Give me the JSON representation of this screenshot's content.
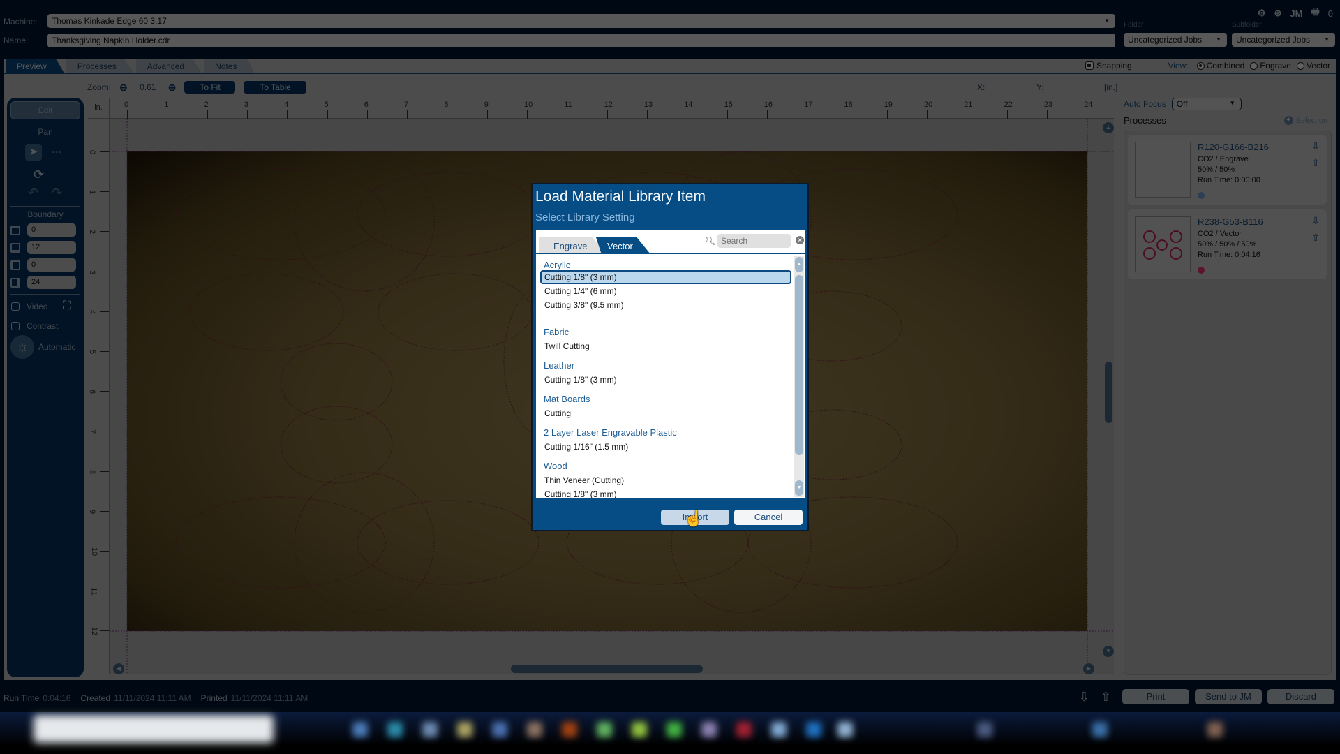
{
  "header": {
    "machine_label": "Machine:",
    "machine_value": "Thomas Kinkade Edge 60 3.17",
    "name_label": "Name:",
    "name_value": "Thanksgiving Napkin Holder.cdr",
    "folder_caption": "Folder",
    "folder_value": "Uncategorized Jobs",
    "subfolder_caption": "Subfolder",
    "subfolder_value": "Uncategorized Jobs",
    "top_icons": [
      "gear-icon",
      "activity-icon",
      "JM",
      "printer-icon",
      "0"
    ],
    "jm_label": "JM",
    "queue_count": "0"
  },
  "tabs": [
    {
      "label": "Preview",
      "active": true
    },
    {
      "label": "Processes",
      "active": false
    },
    {
      "label": "Advanced",
      "active": false
    },
    {
      "label": "Notes",
      "active": false
    }
  ],
  "view": {
    "snapping_label": "Snapping",
    "snapping_checked": true,
    "view_label": "View:",
    "options": [
      {
        "label": "Combined",
        "selected": true
      },
      {
        "label": "Engrave",
        "selected": false
      },
      {
        "label": "Vector",
        "selected": false
      }
    ]
  },
  "zoom": {
    "label": "Zoom:",
    "value": "0.61",
    "to_fit": "To Fit",
    "to_table": "To Table",
    "x_label": "X:",
    "y_label": "Y:",
    "unit": "[in.]"
  },
  "left_panel": {
    "edit_label": "Edit",
    "pan_label": "Pan",
    "tool_placeholder": "---",
    "boundary_label": "Boundary",
    "boundary_values": [
      "0",
      "12",
      "0",
      "24"
    ],
    "video_label": "Video",
    "contrast_label": "Contrast",
    "automatic_label": "Automatic"
  },
  "ruler": {
    "unit": "in.",
    "top_ticks": [
      "0",
      "1",
      "2",
      "3",
      "4",
      "5",
      "6",
      "7",
      "8",
      "9",
      "10",
      "11",
      "12",
      "13",
      "14",
      "15",
      "16",
      "17",
      "18",
      "19",
      "20",
      "21",
      "22",
      "23",
      "24"
    ],
    "left_ticks": [
      "0",
      "1",
      "2",
      "3",
      "4",
      "5",
      "6",
      "7",
      "8",
      "9",
      "10",
      "11",
      "12"
    ]
  },
  "right_panel": {
    "auto_focus_label": "Auto Focus",
    "auto_focus_value": "Off",
    "processes_label": "Processes",
    "selection_label": "Selection",
    "processes": [
      {
        "title": "R120-G166-B216",
        "type": "CO2 / Engrave",
        "settings": "50% / 50%",
        "run_time": "Run Time: 0:00:00",
        "color": "#78a6d8"
      },
      {
        "title": "R238-G53-B116",
        "type": "CO2 / Vector",
        "settings": "50% / 50% / 50%",
        "run_time": "Run Time: 0:04:16",
        "color": "#ee3574"
      }
    ]
  },
  "status": {
    "run_time_label": "Run Time",
    "run_time_value": "0:04:16",
    "created_label": "Created",
    "created_value": "11/11/2024 11:11 AM",
    "printed_label": "Printed",
    "printed_value": "11/11/2024 11:11 AM"
  },
  "actions": {
    "print": "Print",
    "send_to_jm": "Send to JM",
    "discard": "Discard"
  },
  "dialog": {
    "title": "Load Material Library Item",
    "subtitle": "Select Library Setting",
    "tabs": [
      {
        "label": "Engrave",
        "active": false
      },
      {
        "label": "Vector",
        "active": true
      }
    ],
    "search_placeholder": "Search",
    "groups": [
      {
        "category": "Acrylic",
        "items": [
          "Cutting 1/8\" (3 mm)",
          "Cutting 1/4\" (6 mm)",
          "Cutting 3/8\" (9.5 mm)"
        ]
      },
      {
        "category": "Fabric",
        "items": [
          "Twill Cutting"
        ]
      },
      {
        "category": "Leather",
        "items": [
          "Cutting 1/8\" (3 mm)"
        ]
      },
      {
        "category": "Mat Boards",
        "items": [
          "Cutting"
        ]
      },
      {
        "category": "2 Layer Laser Engravable Plastic",
        "items": [
          "Cutting 1/16\" (1.5 mm)"
        ]
      },
      {
        "category": "Wood",
        "items": [
          "Thin Veneer (Cutting)",
          "Cutting 1/8\" (3 mm)"
        ]
      }
    ],
    "selected": "Acrylic / Cutting 1/8\" (3 mm)",
    "import_label": "Import",
    "cancel_label": "Cancel"
  }
}
